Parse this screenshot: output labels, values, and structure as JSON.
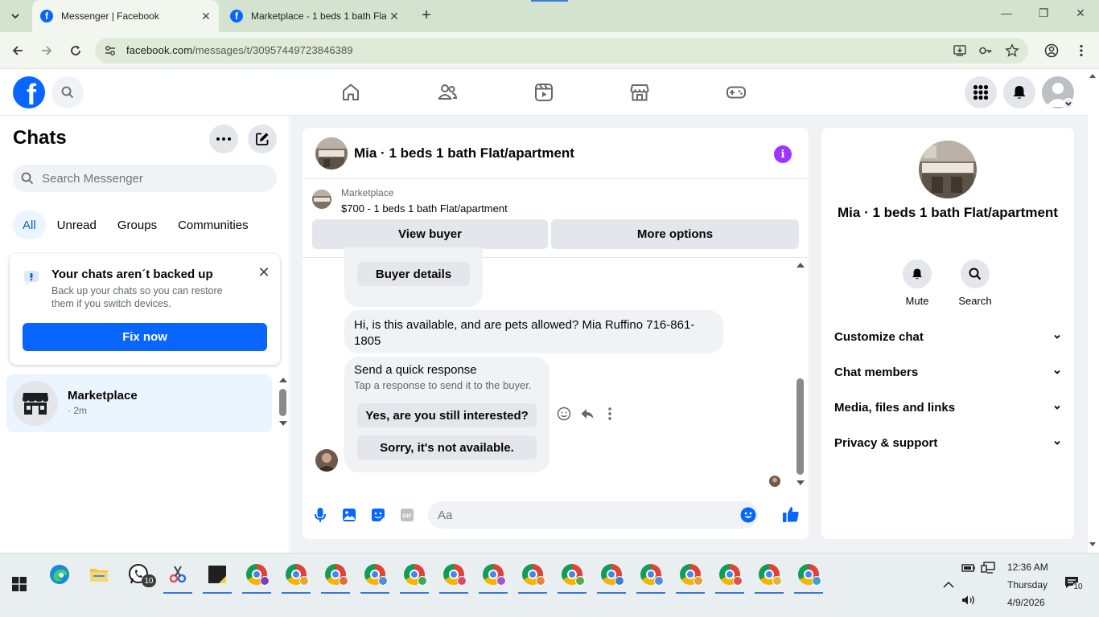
{
  "browser": {
    "tabs": [
      {
        "title": "Messenger | Facebook",
        "active": true
      },
      {
        "title": "Marketplace - 1 beds 1 bath Flat",
        "active": false
      }
    ],
    "url_host": "facebook.com",
    "url_path": "/messages/t/30957449723846389"
  },
  "chats": {
    "title": "Chats",
    "search_placeholder": "Search Messenger",
    "filters": [
      "All",
      "Unread",
      "Groups",
      "Communities"
    ],
    "backup": {
      "title": "Your chats aren´t backed up",
      "description": "Back up your chats so you can restore them if you switch devices.",
      "button": "Fix now"
    },
    "conversation": {
      "name": "Marketplace",
      "subtitle": "· 2m"
    }
  },
  "conversation": {
    "title": "Mia · 1 beds 1 bath Flat/apartment",
    "marketplace_label": "Marketplace",
    "listing": "$700 - 1 beds 1 bath Flat/apartment",
    "view_buyer": "View buyer",
    "more_options": "More options",
    "buyer_details": "Buyer details",
    "message": "Hi, is this available, and are pets allowed? Mia Ruffino 716-861-1805",
    "quick_title": "Send a quick response",
    "quick_sub": "Tap a response to send it to the buyer.",
    "quick_replies": [
      "Yes, are you still interested?",
      "Sorry, it's not available."
    ],
    "input_placeholder": "Aa"
  },
  "details": {
    "name": "Mia · 1 beds 1 bath Flat/apartment",
    "actions": [
      "Mute",
      "Search"
    ],
    "sections": [
      "Customize chat",
      "Chat members",
      "Media, files and links",
      "Privacy & support"
    ]
  },
  "taskbar": {
    "whatsapp_badge": "10",
    "time": "12:36 AM",
    "day": "Thursday",
    "date": "4/9/2026",
    "notif_count": "10"
  },
  "colors": {
    "brand": "#0866ff",
    "accent_filter": "#0064d1",
    "info": "#a033ff"
  }
}
